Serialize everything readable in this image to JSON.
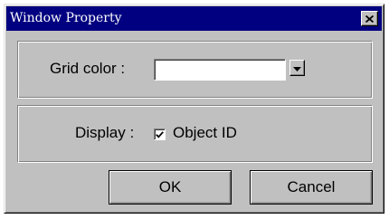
{
  "window": {
    "title": "Window Property"
  },
  "grid_group": {
    "label": "Grid color :",
    "color_value": ""
  },
  "display_group": {
    "label": "Display :",
    "object_id_label": "Object ID",
    "object_id_checked": true
  },
  "buttons": {
    "ok_label": "OK",
    "cancel_label": "Cancel"
  },
  "icons": {
    "close": "close-icon",
    "dropdown": "chevron-down-icon",
    "check": "checkmark-icon"
  },
  "colors": {
    "titlebar": "#000080",
    "dialog_face": "#c0c0c0"
  }
}
